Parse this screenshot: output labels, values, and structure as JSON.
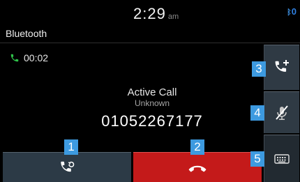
{
  "status_bar": {
    "time": "2:29",
    "ampm": "am",
    "bt_icon": "bluetooth-icon",
    "bt_count": "0"
  },
  "title_bar": {
    "title": "Bluetooth"
  },
  "call": {
    "timer": "00:02",
    "status": "Active Call",
    "name": "Unknown",
    "number": "01052267177"
  },
  "buttons": {
    "swap": {
      "icon": "phone-swap-icon"
    },
    "end": {
      "icon": "hang-up-icon",
      "color": "#c41a1a"
    },
    "add_call": {
      "icon": "phone-add-icon"
    },
    "mute": {
      "icon": "mic-mute-icon"
    },
    "keypad": {
      "icon": "keypad-icon"
    }
  },
  "badges": [
    "1",
    "2",
    "3",
    "4",
    "5"
  ],
  "colors": {
    "background": "#000000",
    "button": "#2f3a44",
    "accent_blue": "#3d9ae0",
    "call_green": "#2fc24a",
    "end_red": "#c41a1a"
  }
}
